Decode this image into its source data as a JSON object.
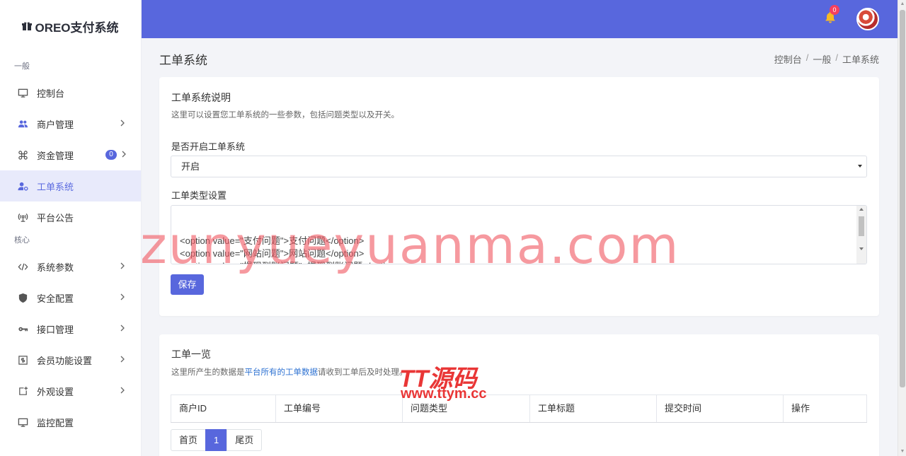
{
  "brand": {
    "name": "OREO支付系统",
    "icon": "gift-icon"
  },
  "sidebar": {
    "sections": [
      {
        "label": "一般"
      },
      {
        "label": "核心"
      }
    ],
    "items": [
      {
        "label": "控制台",
        "icon": "monitor-icon"
      },
      {
        "label": "商户管理",
        "icon": "users-icon"
      },
      {
        "label": "资金管理",
        "icon": "command-icon",
        "badge": "0"
      },
      {
        "label": "工单系统",
        "icon": "user-settings-icon"
      },
      {
        "label": "平台公告",
        "icon": "broadcast-icon"
      },
      {
        "label": "系统参数",
        "icon": "code-icon"
      },
      {
        "label": "安全配置",
        "icon": "shield-icon"
      },
      {
        "label": "接口管理",
        "icon": "key-icon"
      },
      {
        "label": "会员功能设置",
        "icon": "dollar-box-icon"
      },
      {
        "label": "外观设置",
        "icon": "add-box-icon"
      },
      {
        "label": "监控配置",
        "icon": "monitor-icon"
      }
    ]
  },
  "topbar": {
    "notification_count": "0"
  },
  "page": {
    "title": "工单系统",
    "breadcrumb": [
      "控制台",
      "一般",
      "工单系统"
    ]
  },
  "settings_card": {
    "title": "工单系统说明",
    "description": "这里可以设置您工单系统的一些参数，包括问题类型以及开关。",
    "enable_label": "是否开启工单系统",
    "enable_value": "开启",
    "types_label": "工单类型设置",
    "types_value": "<option value=\"支付问题\">支付问题</option>\n<option value=\"网站问题\">网站问题</option>\n<option value=\"提现到账问题\">提现到账问题</option>\n<option value=\"功能问题\">功能问题</option>\n<option value=\"其他问题\">其他问题</option>",
    "save_label": "保存"
  },
  "list_card": {
    "title": "工单一览",
    "desc_prefix": "这里所产生的数据是",
    "desc_link": "平台所有的工单数据",
    "desc_suffix": "请收到工单后及时处理。",
    "columns": [
      "商户ID",
      "工单编号",
      "问题类型",
      "工单标题",
      "提交时间",
      "操作"
    ],
    "pagination": {
      "first": "首页",
      "current": "1",
      "last": "尾页"
    }
  },
  "watermarks": {
    "main": "zunyueyuanma.com",
    "logo": "TT源码",
    "url": "www.ttym.cc"
  }
}
